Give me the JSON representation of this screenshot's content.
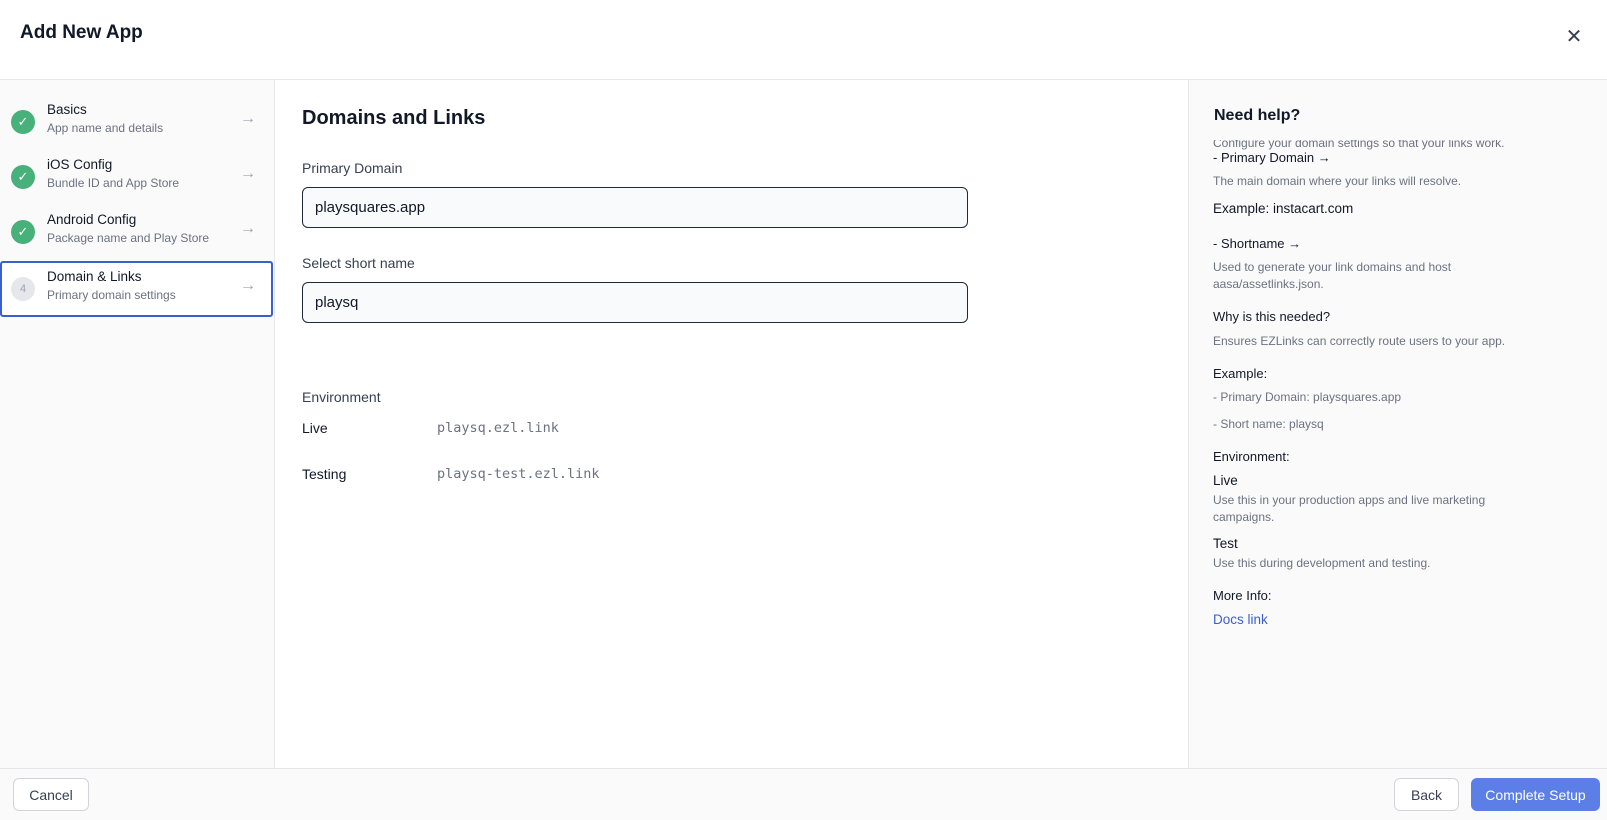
{
  "header": {
    "title": "Add New App",
    "close_symbol": "✕"
  },
  "steps": [
    {
      "title": "Basics",
      "subtitle": "App name and details",
      "status": "complete",
      "marker": "✓"
    },
    {
      "title": "iOS Config",
      "subtitle": "Bundle ID and App Store",
      "status": "complete",
      "marker": "✓"
    },
    {
      "title": "Android Config",
      "subtitle": "Package name and Play Store",
      "status": "complete",
      "marker": "✓"
    },
    {
      "title": "Domain & Links",
      "subtitle": "Primary domain settings",
      "status": "active",
      "marker": "4"
    }
  ],
  "step_arrow": "→",
  "main": {
    "title": "Domains and Links",
    "primary_domain": {
      "label": "Primary Domain",
      "value": "playsquares.app"
    },
    "short_name": {
      "label": "Select short name",
      "value": "playsq"
    },
    "environment": {
      "label": "Environment",
      "rows": [
        {
          "name": "Live",
          "value": "playsq.ezl.link"
        },
        {
          "name": "Testing",
          "value": "playsq-test.ezl.link"
        }
      ]
    }
  },
  "help": {
    "title": "Need help?",
    "clipped_intro": "Configure your domain settings so that your links work.",
    "primary_domain_heading": "- Primary Domain →",
    "primary_domain_text": "The main domain where your links will resolve.",
    "primary_domain_example": "Example: instacart.com",
    "shortname_heading": "- Shortname →",
    "shortname_text": "Used to generate your link domains and host aasa/assetlinks.json.",
    "why_heading": "Why is this needed?",
    "why_text": "Ensures EZLinks can correctly route users to your app.",
    "example_heading": "Example:",
    "example_domain": "- Primary Domain: playsquares.app",
    "example_short": "- Short name: playsq",
    "environment_heading": "Environment:",
    "live_heading": "Live",
    "live_text": "Use this in your production apps and live marketing campaigns.",
    "test_heading": "Test",
    "test_text": "Use this during development and testing.",
    "more_info_heading": "More Info:",
    "docs_link": "Docs link"
  },
  "footer": {
    "cancel": "Cancel",
    "back": "Back",
    "complete": "Complete Setup"
  },
  "colors": {
    "accent": "#3b5fcf",
    "success": "#48b07a",
    "primary_button": "#5b7fe6"
  }
}
